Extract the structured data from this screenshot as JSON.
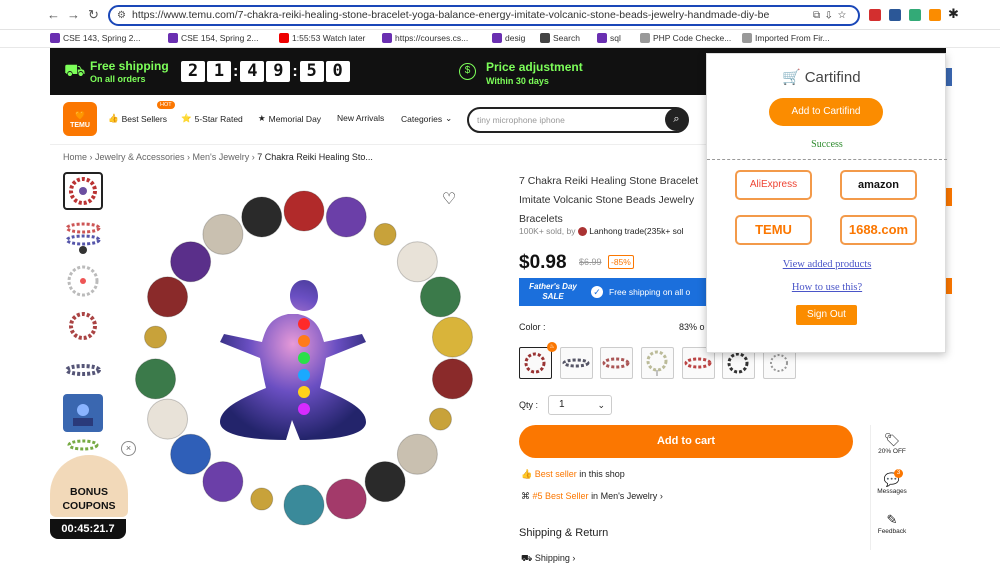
{
  "browser": {
    "url": "https://www.temu.com/7-chakra-reiki-healing-stone-bracelet-yoga-balance-energy-imitate-volcanic-stone-beads-jewelry-handmade-diy-be",
    "bookmarks": [
      {
        "label": "CSE 143, Spring 2...",
        "color": "#6a2fb1"
      },
      {
        "label": "CSE 154, Spring 2...",
        "color": "#6a2fb1"
      },
      {
        "label": "1:55:53 Watch later",
        "color": "#e00"
      },
      {
        "label": "https://courses.cs...",
        "color": "#6a2fb1"
      },
      {
        "label": "desig",
        "color": "#6a2fb1"
      },
      {
        "label": "Search",
        "color": "#444"
      },
      {
        "label": "sql",
        "color": "#6a2fb1"
      },
      {
        "label": "PHP Code Checke...",
        "color": "#999"
      },
      {
        "label": "Imported From Fir...",
        "color": "#999"
      }
    ]
  },
  "promo": {
    "free_shipping": "Free shipping",
    "on_all_orders": "On all orders",
    "countdown": [
      "2",
      "1",
      "4",
      "9",
      "5",
      "0"
    ],
    "price_adjustment": "Price adjustment",
    "within_30_days": "Within 30 days"
  },
  "nav": {
    "logo_text": "TEMU",
    "hot_badge": "HOT",
    "items": [
      "Best Sellers",
      "5-Star Rated",
      "Memorial Day",
      "New Arrivals",
      "Categories"
    ],
    "search_placeholder": "tiny microphone iphone"
  },
  "breadcrumb": [
    "Home",
    "Jewelry & Accessories",
    "Men's Jewelry",
    "7 Chakra Reiki Healing Sto..."
  ],
  "product": {
    "title": "7 Chakra Reiki Healing Stone Bracelet Imitate Volcanic Stone Beads Jewelry Bracelets",
    "sold": "100K+ sold, by",
    "seller": "Lanhong trade(235k+ sol",
    "price": "$0.98",
    "old_price": "$6.99",
    "discount": "-85%",
    "fathers_day": "Father's Day SALE",
    "free_shipping_note": "Free shipping on all o",
    "color_label": "Color :",
    "percent_label": "83% o",
    "qty_label": "Qty :",
    "qty_value": "1",
    "add_to_cart": "Add to cart",
    "best_seller": "Best seller",
    "in_this_shop": "in this shop",
    "rank": "#5 Best Seller",
    "rank_category": "in Men's Jewelry",
    "shipping_return": "Shipping & Return",
    "shipping": "Shipping"
  },
  "bonus": {
    "title": "BONUS COUPONS",
    "timer": "00:45:21.7"
  },
  "rail": [
    {
      "label": "20% OFF",
      "icon": "coupon-icon"
    },
    {
      "label": "Messages",
      "icon": "chat-icon",
      "badge": "3"
    },
    {
      "label": "Feedback",
      "icon": "feedback-icon"
    }
  ],
  "extension": {
    "name": "Cartifind",
    "add_button": "Add to Cartifind",
    "status": "Success",
    "stores": [
      "AliExpress",
      "amazon",
      "TEMU",
      "1688.com"
    ],
    "view_link": "View added products",
    "howto_link": "How to use this?",
    "signout": "Sign Out"
  },
  "colors": {
    "temu_orange": "#fb7701",
    "url_border": "#1a47b8",
    "cartifind_orange": "#fb8c00",
    "success_green": "#2e8b2e"
  }
}
